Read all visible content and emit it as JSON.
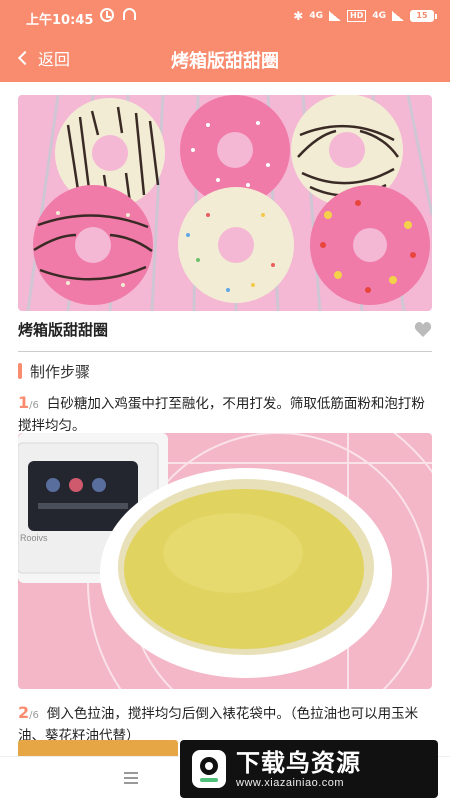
{
  "status_bar": {
    "time": "上午10:45",
    "network_1": "4G",
    "network_2": "4G",
    "hd": "HD",
    "battery": "15"
  },
  "nav": {
    "back_label": "返回",
    "title": "烤箱版甜甜圈"
  },
  "recipe": {
    "title": "烤箱版甜甜圈"
  },
  "steps_section": {
    "label": "制作步骤"
  },
  "steps": [
    {
      "num": "1",
      "total": "/6",
      "text": "白砂糖加入鸡蛋中打至融化，不用打发。筛取低筋面粉和泡打粉搅拌均匀。"
    },
    {
      "num": "2",
      "total": "/6",
      "text": "倒入色拉油，搅拌均匀后倒入裱花袋中。（色拉油也可以用玉米油、葵花籽油代替）"
    }
  ],
  "scale_panel": {
    "brand": "Rooivs"
  },
  "watermark": {
    "name": "下载鸟资源",
    "url": "www.xiazainiao.com"
  },
  "colors": {
    "accent": "#f98c6f",
    "background": "#ffffff",
    "divider": "#cccccc"
  },
  "icons": [
    "alarm-icon",
    "headset-icon",
    "bluetooth-icon",
    "signal-icon",
    "battery-icon",
    "back-chevron-icon",
    "heart-icon",
    "menu-icon"
  ]
}
